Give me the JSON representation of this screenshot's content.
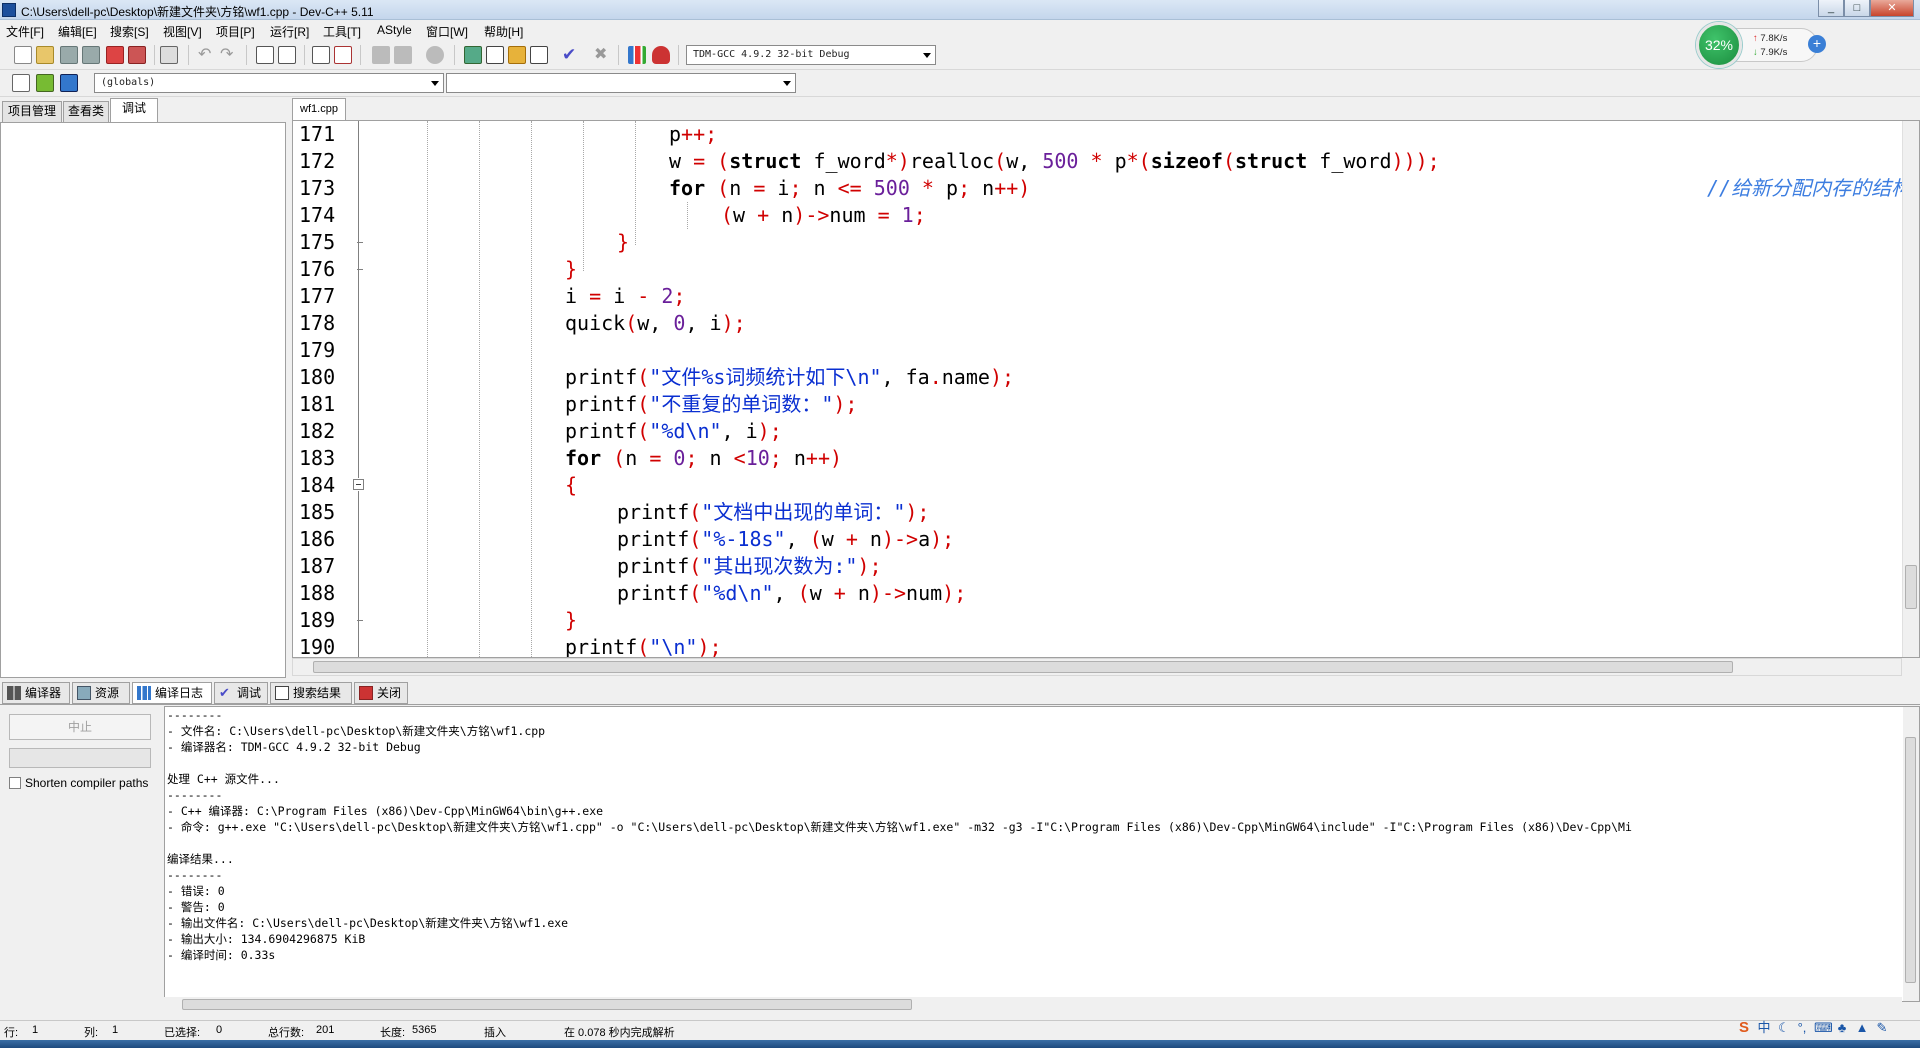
{
  "window": {
    "title": "C:\\Users\\dell-pc\\Desktop\\新建文件夹\\方铭\\wf1.cpp - Dev-C++ 5.11",
    "minimize_label": "_",
    "maximize_label": "□",
    "close_label": "✕"
  },
  "menu": [
    "文件[F]",
    "编辑[E]",
    "搜索[S]",
    "视图[V]",
    "项目[P]",
    "运行[R]",
    "工具[T]",
    "AStyle",
    "窗口[W]",
    "帮助[H]"
  ],
  "toolbar": {
    "compiler_select": "TDM-GCC 4.9.2 32-bit Debug",
    "scope_select": "(globals)",
    "symbol_select": ""
  },
  "left_tabs": [
    "项目管理",
    "查看类",
    "调试"
  ],
  "editor": {
    "file_tab": "wf1.cpp",
    "line_numbers": [
      "171",
      "172",
      "173",
      "174",
      "175",
      "176",
      "177",
      "178",
      "179",
      "180",
      "181",
      "182",
      "183",
      "184",
      "185",
      "186",
      "187",
      "188",
      "189",
      "190"
    ],
    "comment_173": "//给新分配内存的结构体"
  },
  "bottom_tabs": [
    "编译器",
    "资源",
    "编译日志",
    "调试",
    "搜索结果",
    "关闭"
  ],
  "compile": {
    "stop_button": "中止",
    "shorten_paths": "Shorten compiler paths",
    "log": [
      "--------",
      "- 文件名: C:\\Users\\dell-pc\\Desktop\\新建文件夹\\方铭\\wf1.cpp",
      "- 编译器名: TDM-GCC 4.9.2 32-bit Debug",
      "",
      "处理 C++ 源文件...",
      "--------",
      "- C++ 编译器: C:\\Program Files (x86)\\Dev-Cpp\\MinGW64\\bin\\g++.exe",
      "- 命令: g++.exe \"C:\\Users\\dell-pc\\Desktop\\新建文件夹\\方铭\\wf1.cpp\" -o \"C:\\Users\\dell-pc\\Desktop\\新建文件夹\\方铭\\wf1.exe\" -m32 -g3 -I\"C:\\Program Files (x86)\\Dev-Cpp\\MinGW64\\include\" -I\"C:\\Program Files (x86)\\Dev-Cpp\\Mi",
      "",
      "编译结果...",
      "--------",
      "- 错误: 0",
      "- 警告: 0",
      "- 输出文件名: C:\\Users\\dell-pc\\Desktop\\新建文件夹\\方铭\\wf1.exe",
      "- 输出大小: 134.6904296875 KiB",
      "- 编译时间: 0.33s"
    ]
  },
  "status": {
    "row_label": "行:",
    "row": "1",
    "col_label": "列:",
    "col": "1",
    "sel_label": "已选择:",
    "sel": "0",
    "lines_label": "总行数:",
    "lines": "201",
    "len_label": "长度:",
    "len": "5365",
    "mode": "插入",
    "message": "在 0.078 秒内完成解析"
  },
  "net": {
    "cpu": "32%",
    "up": "7.8K/s",
    "down": "7.9K/s",
    "plus": "+"
  },
  "tray": {
    "ime": "S",
    "lang": "中"
  }
}
